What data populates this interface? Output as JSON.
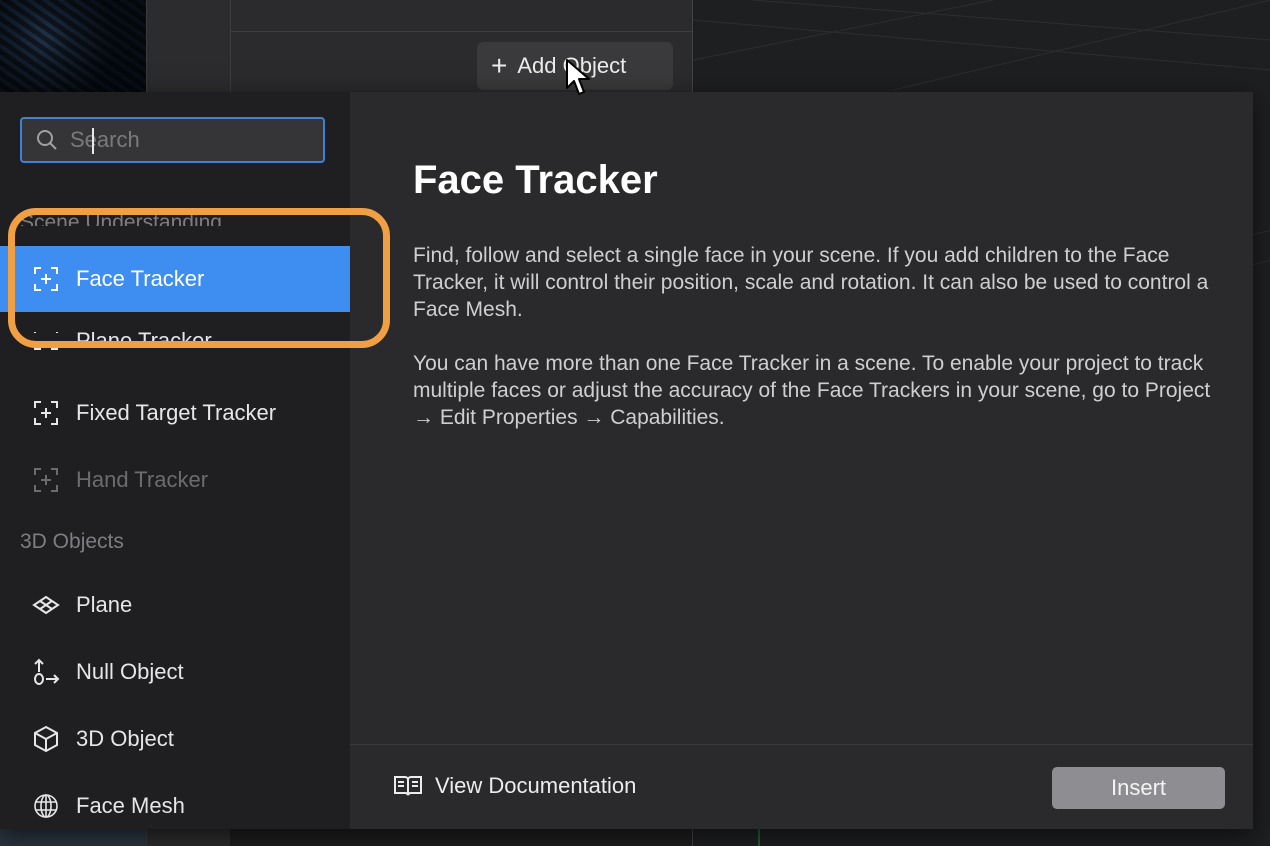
{
  "background": {
    "add_object_label": "Add Object"
  },
  "dialog": {
    "search": {
      "placeholder": "Search",
      "value": ""
    },
    "sidebar": {
      "section_scene": "Scene Understanding",
      "section_3d": "3D Objects",
      "items": [
        {
          "label": "Face Tracker",
          "icon": "face-tracker-icon",
          "state": "selected"
        },
        {
          "label": "Plane Tracker",
          "icon": "plane-tracker-icon",
          "state": "partially-hidden"
        },
        {
          "label": "Fixed Target Tracker",
          "icon": "fixed-target-tracker-icon",
          "state": "normal"
        },
        {
          "label": "Hand Tracker",
          "icon": "hand-tracker-icon",
          "state": "disabled"
        },
        {
          "label": "Plane",
          "icon": "plane-icon",
          "state": "normal"
        },
        {
          "label": "Null Object",
          "icon": "null-object-icon",
          "state": "normal"
        },
        {
          "label": "3D Object",
          "icon": "3d-object-icon",
          "state": "normal"
        },
        {
          "label": "Face Mesh",
          "icon": "face-mesh-icon",
          "state": "normal"
        }
      ]
    },
    "detail": {
      "title": "Face Tracker",
      "paragraph1": "Find, follow and select a single face in your scene. If you add children to the Face Tracker, it will control their position, scale and rotation. It can also be used to control a Face Mesh.",
      "paragraph2": "You can have more than one Face Tracker in a scene. To enable your project to track multiple faces or adjust the accuracy of the Face Trackers in your scene, go to Project → Edit Properties → Capabilities."
    },
    "footer": {
      "doc_label": "View Documentation",
      "insert_label": "Insert"
    }
  },
  "colors": {
    "selection": "#3d8ef0",
    "highlight_ring": "#f0a043",
    "search_focus": "#3b82d9"
  }
}
